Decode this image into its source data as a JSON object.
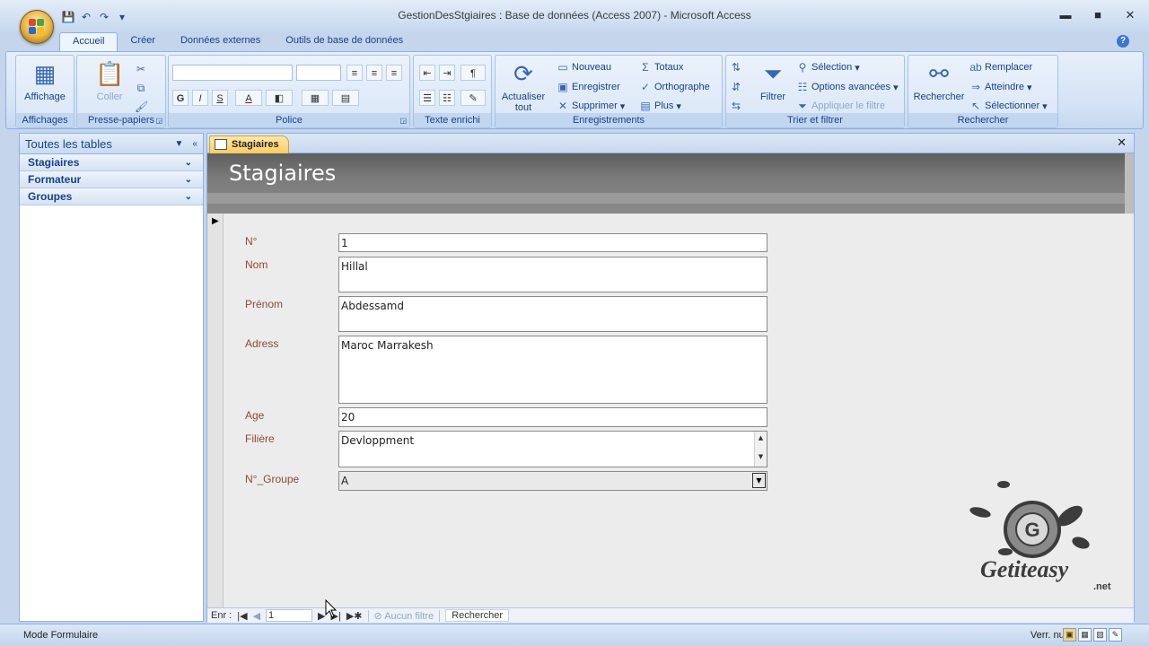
{
  "window": {
    "title": "GestionDesStgiaires : Base de données (Access 2007) - Microsoft Access",
    "minimize": "▬",
    "maximize": "■",
    "close": "✕"
  },
  "qat": {
    "save": "💾",
    "undo": "↶",
    "redo": "↷",
    "customize": "▾"
  },
  "tabs": [
    "Accueil",
    "Créer",
    "Données externes",
    "Outils de base de données"
  ],
  "help": "?",
  "ribbon": {
    "affichages": {
      "group": "Affichages",
      "btn": "Affichage"
    },
    "presse": {
      "group": "Presse-papiers",
      "coller": "Coller"
    },
    "police": {
      "group": "Police",
      "bold": "G",
      "italic": "I",
      "underline": "S",
      "fontcolor": "A"
    },
    "texte": {
      "group": "Texte enrichi"
    },
    "enreg": {
      "group": "Enregistrements",
      "actualiser": "Actualiser tout",
      "nouveau": "Nouveau",
      "enregistrer": "Enregistrer",
      "supprimer": "Supprimer",
      "totaux": "Totaux",
      "orthographe": "Orthographe",
      "plus": "Plus"
    },
    "trier": {
      "group": "Trier et filtrer",
      "filtrer": "Filtrer",
      "selection": "Sélection",
      "options": "Options avancées",
      "appliquer": "Appliquer le filtre"
    },
    "rechercher": {
      "group": "Rechercher",
      "btn": "Rechercher",
      "remplacer": "Remplacer",
      "atteindre": "Atteindre",
      "selectionner": "Sélectionner"
    }
  },
  "nav": {
    "header": "Toutes les tables",
    "groups": [
      "Stagiaires",
      "Formateur",
      "Groupes"
    ]
  },
  "doc": {
    "tab": "Stagiaires",
    "form_title": "Stagiaires",
    "fields": [
      {
        "label": "N°",
        "value": "1"
      },
      {
        "label": "Nom",
        "value": "Hillal"
      },
      {
        "label": "Prénom",
        "value": "Abdessamd"
      },
      {
        "label": "Adress",
        "value": "Maroc Marrakesh"
      },
      {
        "label": "Age",
        "value": "20"
      },
      {
        "label": "Filière",
        "value": "Devloppment"
      },
      {
        "label": "N°_Groupe",
        "value": "A"
      }
    ],
    "recnav": {
      "label": "Enr :",
      "current": "1",
      "filter": "Aucun filtre",
      "search": "Rechercher"
    }
  },
  "status": {
    "mode": "Mode Formulaire",
    "num": "Verr. num."
  },
  "watermark": {
    "text": "Getiteasy",
    "suffix": ".net",
    "letter": "G"
  },
  "colors": {
    "label": "#8b4a33",
    "ribbon_text": "#15428b",
    "form_header": "#6b6b6b"
  }
}
